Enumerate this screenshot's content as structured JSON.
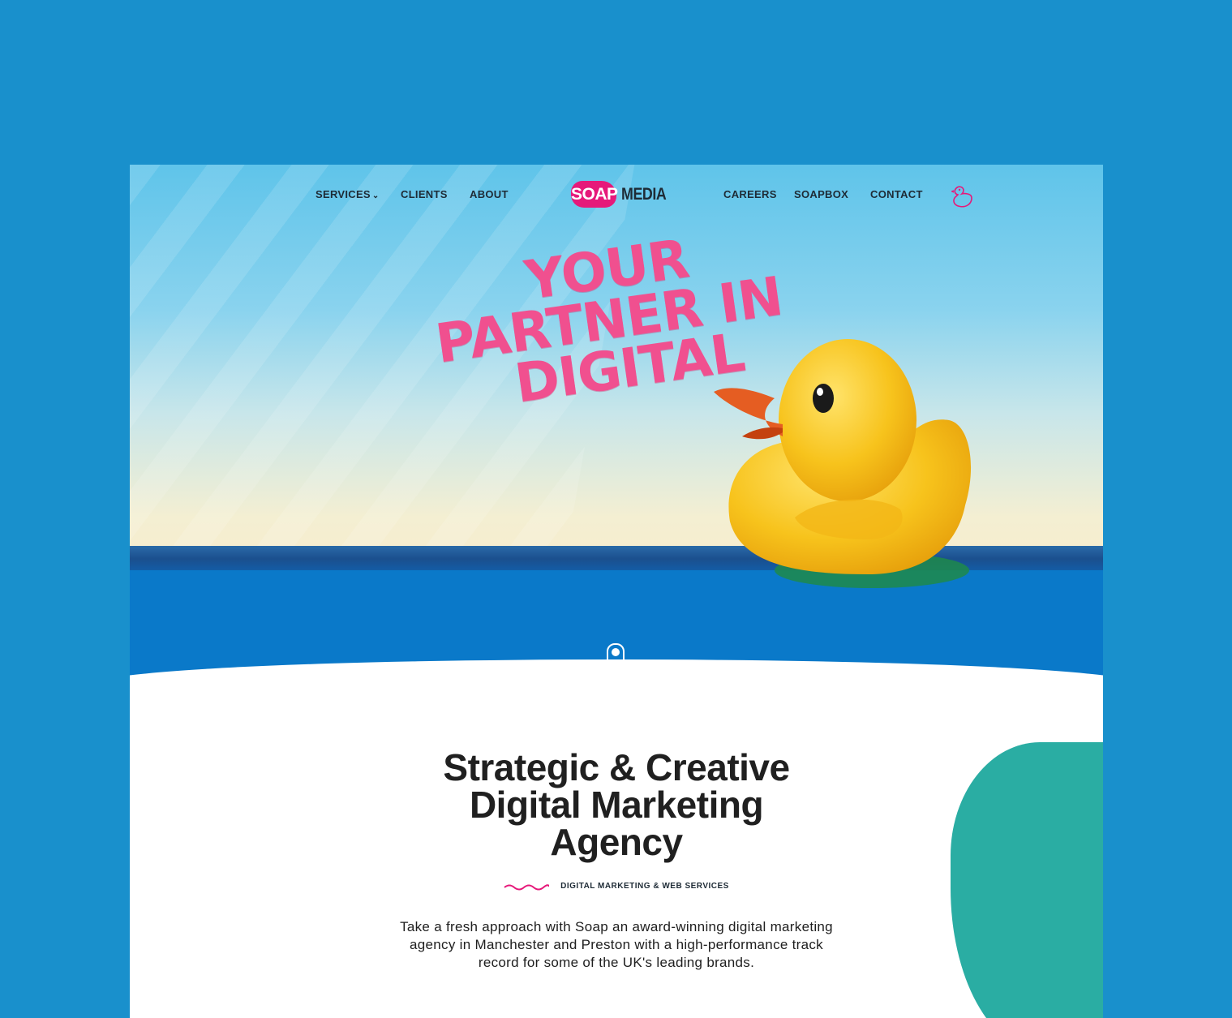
{
  "colors": {
    "page_background": "#1990cc",
    "brand_pink": "#e6197a",
    "headline_pink": "#f0508f",
    "nav_text": "#1e2b36",
    "water_blue": "#0a79c9",
    "blob_teal": "#2aada3",
    "duck_yellow": "#f7c31c"
  },
  "nav": {
    "left": [
      {
        "label": "SERVICES",
        "icon": "chevron-down-icon"
      },
      {
        "label": "CLIENTS"
      },
      {
        "label": "ABOUT"
      }
    ],
    "right": [
      {
        "label": "CAREERS"
      },
      {
        "label": "SOAPBOX"
      },
      {
        "label": "CONTACT"
      }
    ],
    "logo": {
      "badge": "SOAP",
      "word": "MEDIA"
    },
    "duck_icon": "duck-outline-icon"
  },
  "hero": {
    "headline_lines": [
      "YOUR",
      "PARTNER IN",
      "DIGITAL"
    ],
    "scroll_icon": "scroll-mouse-icon"
  },
  "intro": {
    "title_lines": [
      "Strategic & Creative",
      "Digital Marketing",
      "Agency"
    ],
    "tagline": "DIGITAL MARKETING & WEB SERVICES",
    "description": "Take a fresh approach with Soap an award-winning digital marketing agency in Manchester and Preston with a high-performance track record for some of the UK's leading brands."
  }
}
